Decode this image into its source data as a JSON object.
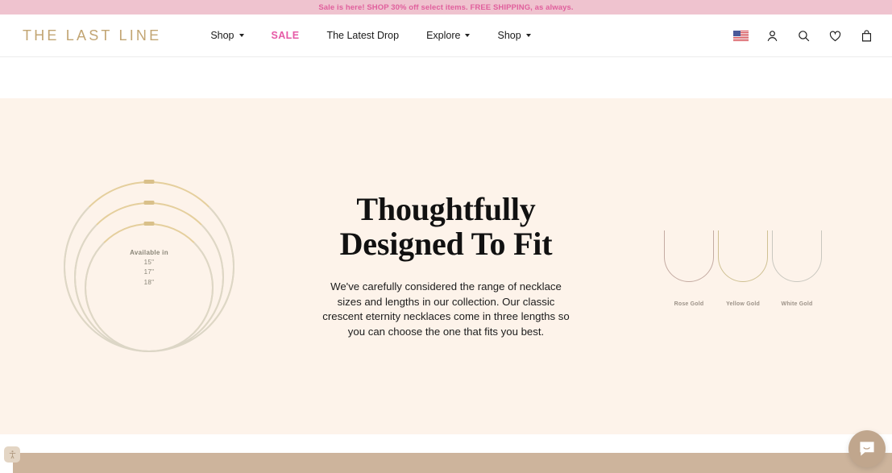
{
  "announcement": {
    "text": "Sale is here! SHOP 30% off select items. FREE SHIPPING, as always.",
    "bg_color": "#efc3cf",
    "text_color": "#e0609d"
  },
  "header": {
    "logo": "THE LAST LINE",
    "logo_color": "#c2a573",
    "nav": [
      {
        "label": "Shop",
        "has_caret": true,
        "highlight": false
      },
      {
        "label": "SALE",
        "has_caret": false,
        "highlight": true
      },
      {
        "label": "The Latest Drop",
        "has_caret": false,
        "highlight": false
      },
      {
        "label": "Explore",
        "has_caret": true,
        "highlight": false
      },
      {
        "label": "Shop",
        "has_caret": true,
        "highlight": false
      }
    ],
    "sale_color": "#e659a6",
    "icons": [
      {
        "name": "us-flag-icon",
        "label": "United States"
      },
      {
        "name": "account-icon",
        "label": "Account"
      },
      {
        "name": "search-icon",
        "label": "Search"
      },
      {
        "name": "wishlist-heart-icon",
        "label": "Wishlist"
      },
      {
        "name": "shopping-bag-icon",
        "label": "Bag"
      }
    ]
  },
  "hero": {
    "bg_color": "#fdf3ea",
    "title_line1": "Thoughtfully",
    "title_line2": "Designed To Fit",
    "body": "We've carefully considered the range of necklace sizes and lengths in our collection. Our classic crescent eternity necklaces come in three lengths so you can choose the one that fits you best.",
    "necklace_graphic": {
      "caption": "Available in",
      "sizes": [
        "15\"",
        "17\"",
        "18\""
      ],
      "ring_count": 3
    },
    "metals": [
      {
        "label": "Rose Gold",
        "color": "#c4aba2"
      },
      {
        "label": "Yellow Gold",
        "color": "#cfc193"
      },
      {
        "label": "White Gold",
        "color": "#c9c7bf"
      }
    ]
  },
  "footer_strip": {
    "bar_color": "#cdb49c"
  },
  "widgets": {
    "accessibility": {
      "name": "accessibility-icon",
      "label": "Accessibility options"
    },
    "chat": {
      "name": "chat-bubble-icon",
      "label": "Open messenger",
      "color": "#c0a68d"
    }
  }
}
